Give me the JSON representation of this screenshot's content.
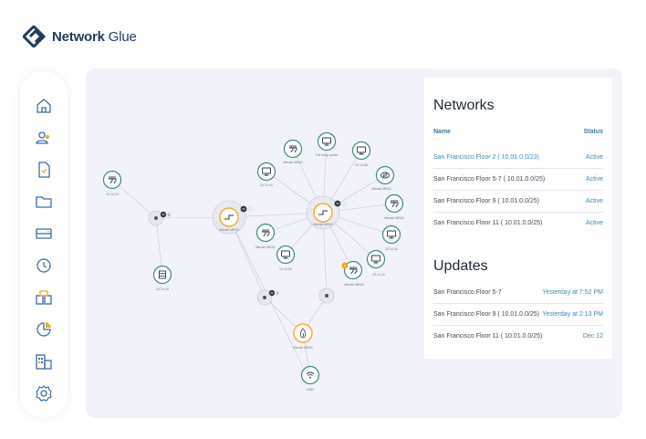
{
  "brand": {
    "bold": "Network",
    "light": " Glue"
  },
  "sidebar": {
    "items": [
      {
        "name": "home-icon",
        "y": 0
      },
      {
        "name": "users-icon",
        "y": 1
      },
      {
        "name": "document-icon",
        "y": 2
      },
      {
        "name": "folder-icon",
        "y": 3
      },
      {
        "name": "server-icon",
        "y": 4
      },
      {
        "name": "clock-icon",
        "y": 5
      },
      {
        "name": "boxes-icon",
        "y": 6
      },
      {
        "name": "pie-chart-icon",
        "y": 7
      },
      {
        "name": "building-icon",
        "y": 8
      },
      {
        "name": "settings-icon",
        "y": 9
      }
    ]
  },
  "networks": {
    "title": "Networks",
    "col_name": "Name",
    "col_status": "Status",
    "rows": [
      {
        "name": "San Francisco Floor 2 ( 10.01.0.0/23)",
        "status": "Active"
      },
      {
        "name": "San Francisco Floor 5-7 ( 10.01.0.0/25)",
        "status": "Active"
      },
      {
        "name": "San Francisco Floor 9 ( 10.01.0.0/25)",
        "status": "Active"
      },
      {
        "name": "San Francisco Floor 11 ( 10.01.0.0/25)",
        "status": "Active"
      }
    ]
  },
  "updates": {
    "title": "Updates",
    "rows": [
      {
        "name": "San Francisco Floor 5-7",
        "time": "Yesterday at 7:52 PM"
      },
      {
        "name": "San Francisco Floor 9 ( 10.01.0.0/25)",
        "time": "Yesterday at 2:13 PM"
      },
      {
        "name": "San Francisco Floor 11 ( 10.01.0.0/25)",
        "time": "Dec 12"
      }
    ]
  },
  "graph": {
    "nodes": [
      {
        "id": "n1",
        "type": "device",
        "icon": "plug",
        "label": "10.14.23"
      },
      {
        "id": "n2",
        "type": "device",
        "icon": "server",
        "label": "10.14.26"
      },
      {
        "id": "h1",
        "type": "hub",
        "badge": "3"
      },
      {
        "id": "s1",
        "type": "switch",
        "label": "Meraki MR42"
      },
      {
        "id": "n3",
        "type": "device",
        "icon": "monitor",
        "label": "10.14.41"
      },
      {
        "id": "n4",
        "type": "device",
        "icon": "plug",
        "label": "Meraki MR42"
      },
      {
        "id": "n5",
        "type": "device",
        "icon": "monitor",
        "label": "Fat shop works"
      },
      {
        "id": "n6",
        "type": "device",
        "icon": "monitor",
        "label": "10.14.86"
      },
      {
        "id": "n7",
        "type": "device",
        "icon": "router",
        "label": "Meraki MR42"
      },
      {
        "id": "n8",
        "type": "device",
        "icon": "plug",
        "label": "Meraki MR42"
      },
      {
        "id": "s2",
        "type": "switch",
        "label": "Meraki MR42"
      },
      {
        "id": "n9",
        "type": "device",
        "icon": "plug",
        "label": "Meraki MR42"
      },
      {
        "id": "n10",
        "type": "device",
        "icon": "monitor",
        "label": "10.14.54"
      },
      {
        "id": "n11",
        "type": "device",
        "icon": "monitor",
        "label": "10.14.00"
      },
      {
        "id": "n12",
        "type": "device",
        "icon": "monitor",
        "label": "10.14.41"
      },
      {
        "id": "n13",
        "type": "device",
        "icon": "plug",
        "label": "Meraki MR42",
        "alert": "!"
      },
      {
        "id": "h2",
        "type": "hub",
        "badge": "2"
      },
      {
        "id": "h3",
        "type": "hub"
      },
      {
        "id": "f1",
        "type": "firewall",
        "label": "Meraki MR42"
      },
      {
        "id": "w1",
        "type": "device",
        "icon": "wifi",
        "label": "US87"
      }
    ]
  },
  "colors": {
    "accent": "#f0a92e",
    "teal": "#3e8a80",
    "link": "#3b8ab0"
  }
}
